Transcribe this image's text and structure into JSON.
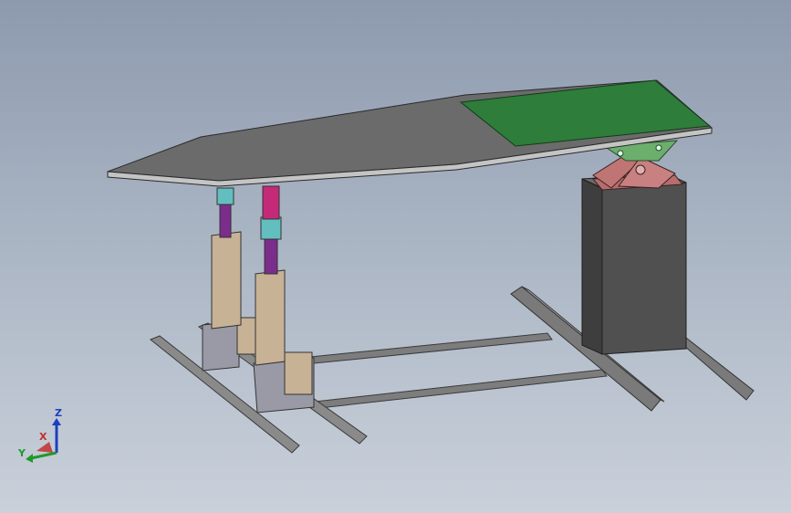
{
  "scene": {
    "background_top": "#8d9aae",
    "background_bottom": "#c9d0da",
    "colors": {
      "platform_top": "#6b6b6b",
      "platform_edge": "#c4c4c4",
      "green_pad": "#2e7d3a",
      "pillar_dark": "#4a4a4a",
      "bracket_red": "#c07575",
      "bracket_green": "#6cae6c",
      "actuator_tan": "#c7b296",
      "actuator_purple": "#7b2d8c",
      "coupling_cyan": "#63bfbf",
      "coupling_magenta": "#c42a78",
      "base_block_gray": "#9a9aa6",
      "rail_gray": "#7d7d7d"
    }
  },
  "triad": {
    "z_label": "Z",
    "x_label": "X",
    "y_label": "Y",
    "z_color": "#1c3fbf",
    "x_color": "#c03030",
    "y_color": "#1e9a2a"
  }
}
